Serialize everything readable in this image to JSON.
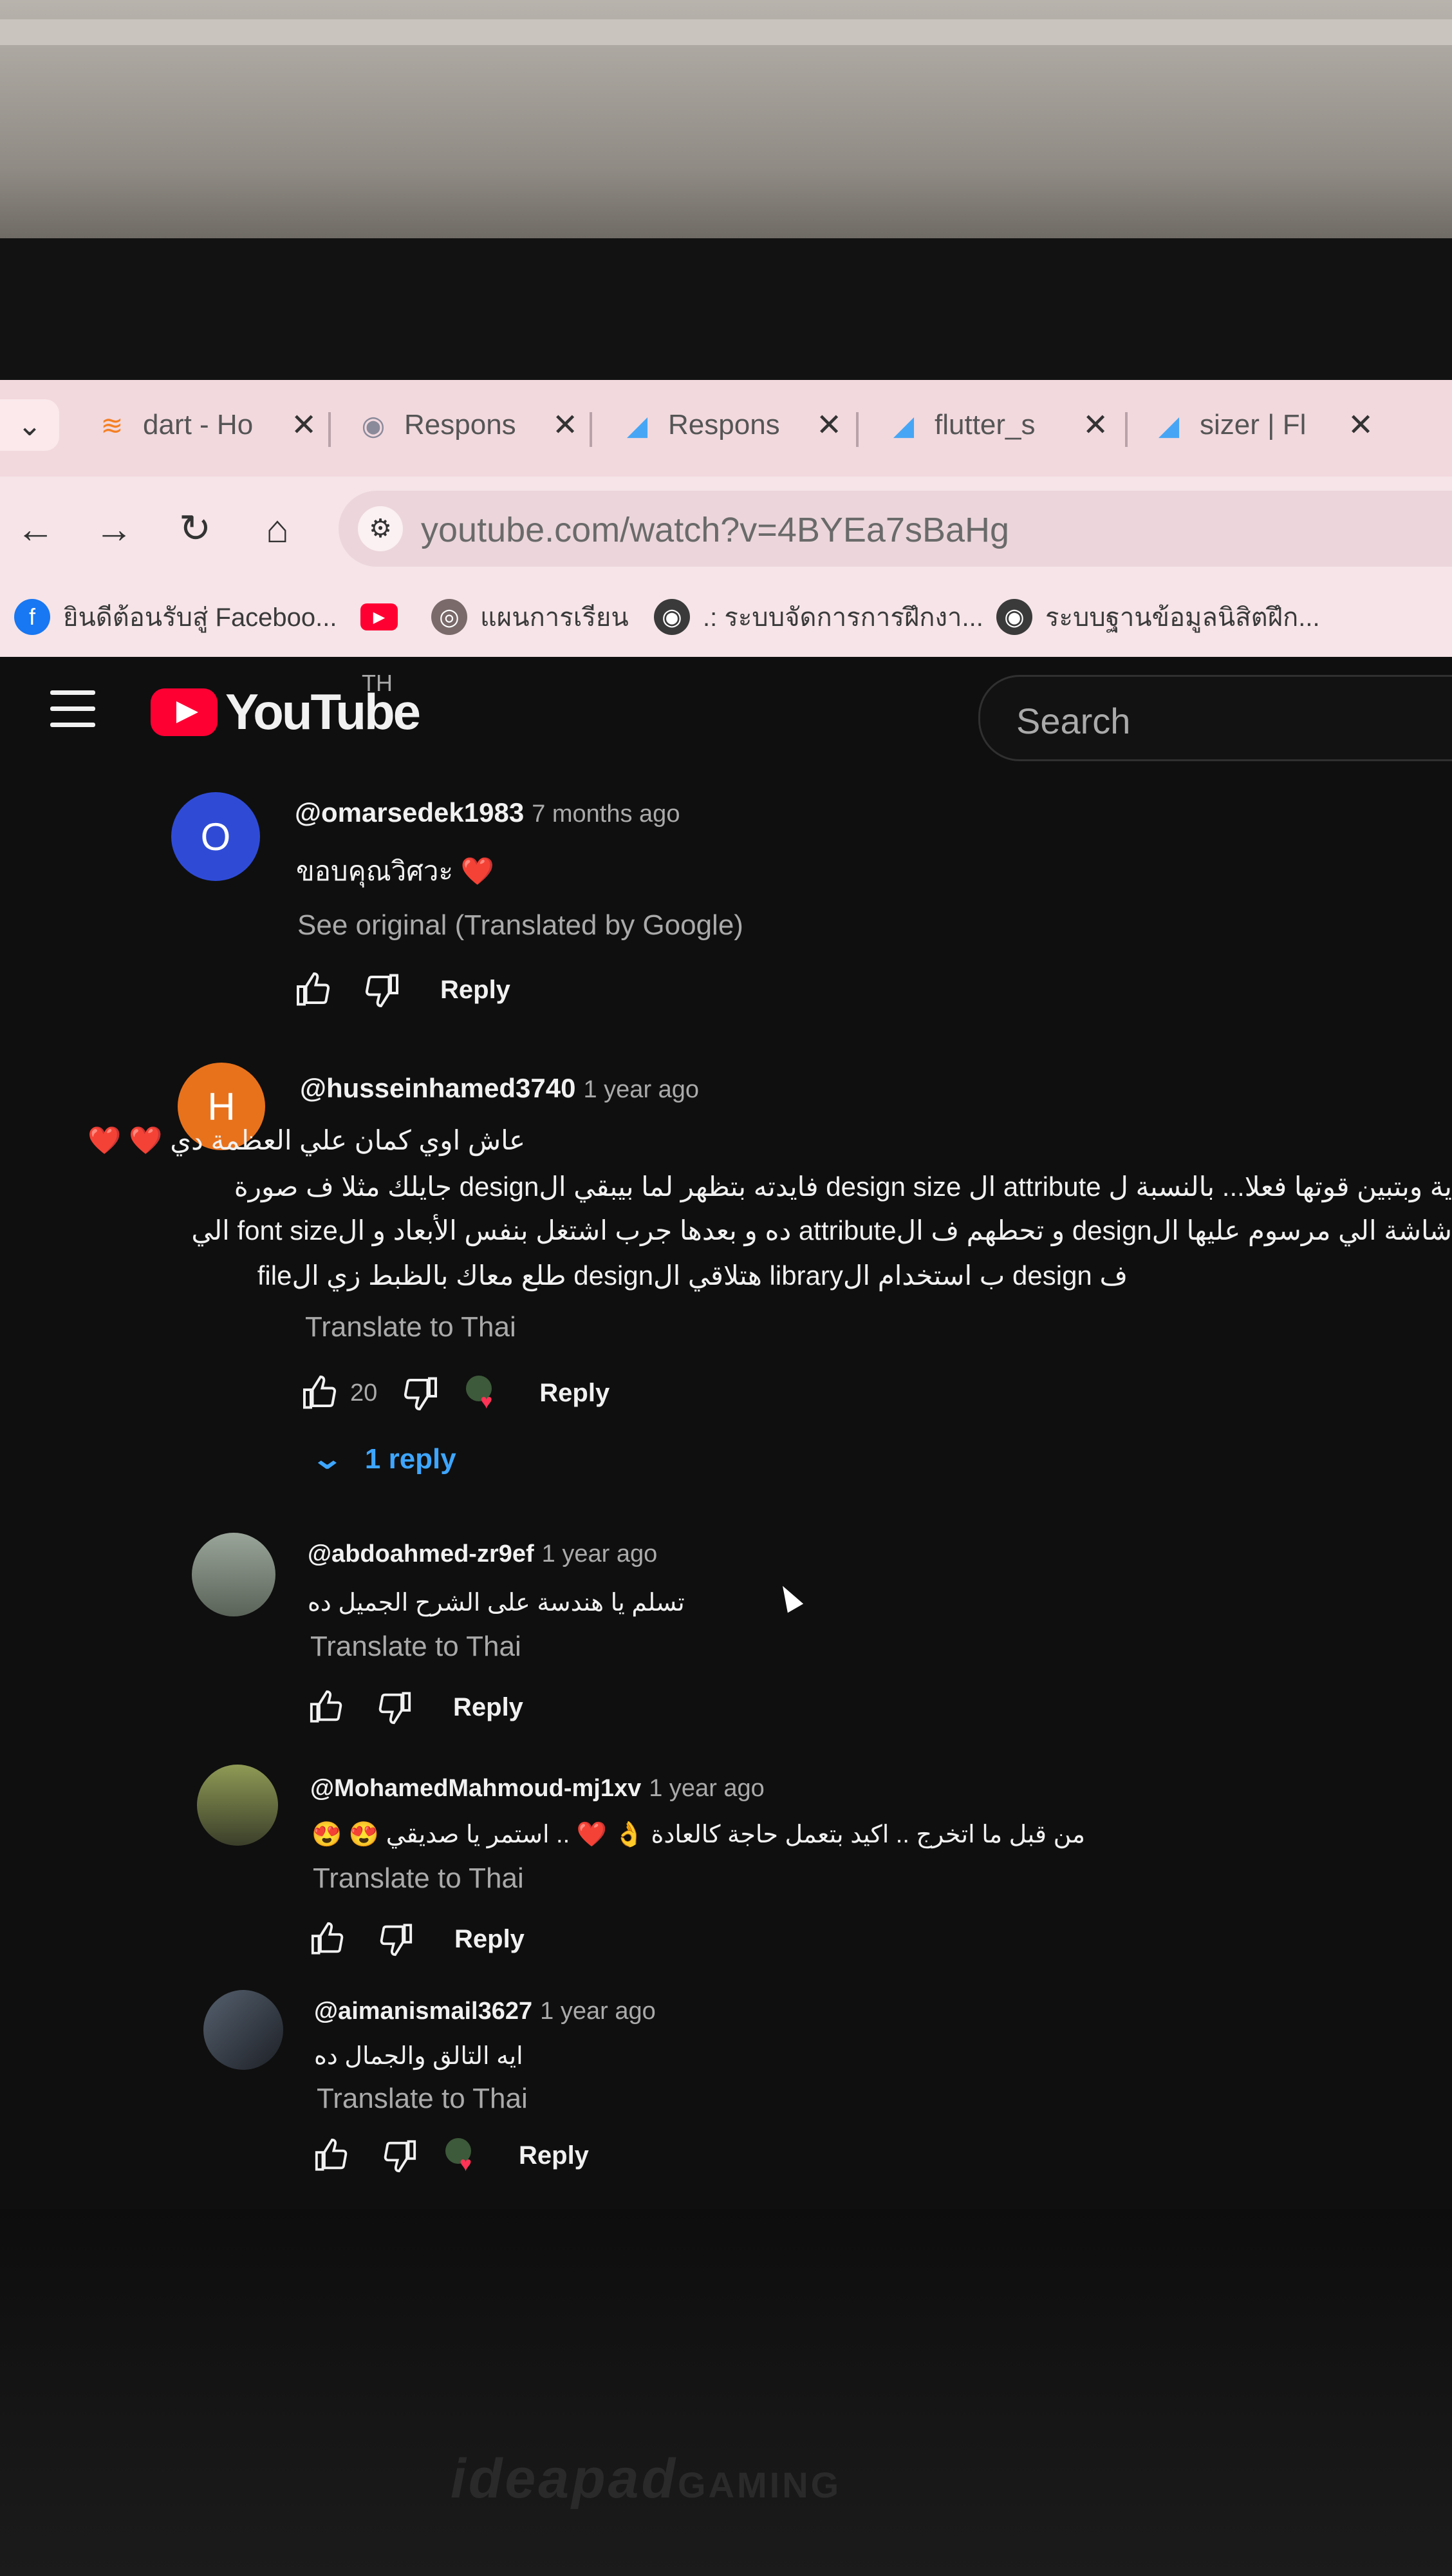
{
  "browser": {
    "tabs": [
      {
        "title": "dart - Ho",
        "icon": "stackoverflow-icon"
      },
      {
        "title": "Respons",
        "icon": "globe-icon"
      },
      {
        "title": "Respons",
        "icon": "flutter-icon"
      },
      {
        "title": "flutter_s",
        "icon": "flutter-icon"
      },
      {
        "title": "sizer | Fl",
        "icon": "flutter-icon"
      }
    ],
    "url": "youtube.com/watch?v=4BYEa7sBaHg",
    "bookmarks": [
      {
        "label": "ยินดีต้อนรับสู่ Faceboo...",
        "icon": "facebook-icon",
        "color": "#1877f2"
      },
      {
        "label": "",
        "icon": "youtube-icon",
        "color": "#ff0033"
      },
      {
        "label": "แผนการเรียน",
        "icon": "app-icon",
        "color": "#7a6a6a"
      },
      {
        "label": ".: ระบบจัดการการฝึกงา...",
        "icon": "globe-icon",
        "color": "#3a3a3a"
      },
      {
        "label": "ระบบฐานข้อมูลนิสิตฝึก...",
        "icon": "globe-icon",
        "color": "#3a3a3a"
      }
    ]
  },
  "youtube": {
    "logo_text": "YouTube",
    "region": "TH",
    "search_placeholder": "Search"
  },
  "comments": [
    {
      "author": "@omarsedek1983",
      "time": "7 months ago",
      "avatar_letter": "O",
      "avatar_color": "#2f4bd6",
      "lines": [
        "ขอบคุณวิศวะ ❤️"
      ],
      "link": "See original (Translated by Google)",
      "likes": "",
      "reply_label": "Reply"
    },
    {
      "author": "@husseinhamed3740",
      "time": "1 year ago",
      "avatar_letter": "H",
      "avatar_color": "#e8721c",
      "lines": [
        "عاش اوي كمان علي العظمة دي ❤️ ❤️",
        "ية وبتبين قوتها فعلا... بالنسبة ل attribute ال design size فايدته بتظهر لما بيبقي الdesign جايلك مثلا ف صورة",
        "شاشة الي مرسوم عليها الdesign و تحطهم ف الattribute ده و بعدها جرب اشتغل بنفس الأبعاد و الfont size الي",
        "ف design ب استخدام  الlibrary هتلاقي الdesign طلع معاك بالظبط زي الfile"
      ],
      "link": "Translate to Thai",
      "likes": "20",
      "reply_label": "Reply",
      "replies_label": "1 reply"
    },
    {
      "author": "@abdoahmed-zr9ef",
      "time": "1 year ago",
      "avatar_color": "#6d7a6a",
      "lines": [
        "تسلم يا هندسة على الشرح الجميل ده"
      ],
      "link": "Translate to Thai",
      "likes": "",
      "reply_label": "Reply"
    },
    {
      "author": "@MohamedMahmoud-mj1xv",
      "time": "1 year ago",
      "avatar_color": "#7c8a4c",
      "lines": [
        "من قبل ما اتخرج .. اكيد بتعمل حاجة كالعادة 👌 ❤️ .. استمر يا صديقي 😍 😍"
      ],
      "link": "Translate to Thai",
      "likes": "",
      "reply_label": "Reply"
    },
    {
      "author": "@aimanismail3627",
      "time": "1 year ago",
      "avatar_color": "#3a3f48",
      "lines": [
        "ايه التالق والجمال ده"
      ],
      "link": "Translate to Thai",
      "likes": "",
      "reply_label": "Reply"
    }
  ],
  "device": {
    "brand": "ideapad",
    "brand_sub": "GAMING"
  }
}
